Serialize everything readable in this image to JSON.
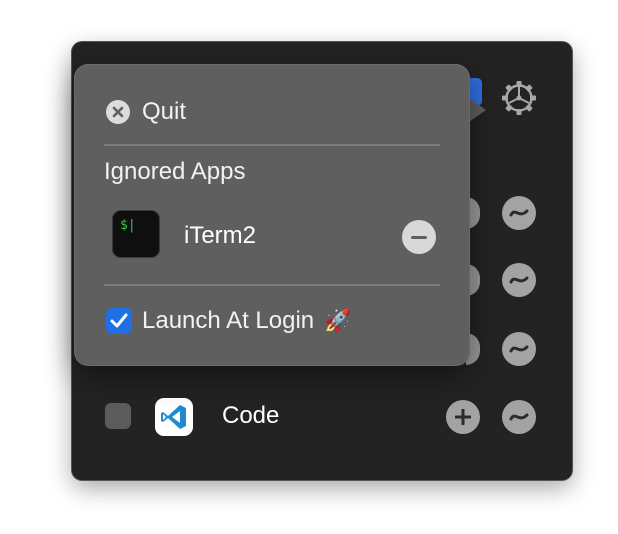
{
  "popover": {
    "quit_label": "Quit",
    "section_title": "Ignored Apps",
    "ignored_apps": [
      {
        "name": "iTerm2",
        "icon": "iterm2-icon",
        "icon_text": "$|"
      }
    ],
    "launch_at_login_label": "Launch At Login",
    "launch_at_login_emoji": "🚀",
    "launch_at_login_checked": true
  },
  "panel": {
    "rows": [
      {
        "name": "Code",
        "icon": "vscode-icon",
        "checked": false
      }
    ]
  },
  "colors": {
    "panel_bg": "#232323",
    "popover_bg": "#5f5f5f",
    "accent": "#1f6fe6"
  }
}
